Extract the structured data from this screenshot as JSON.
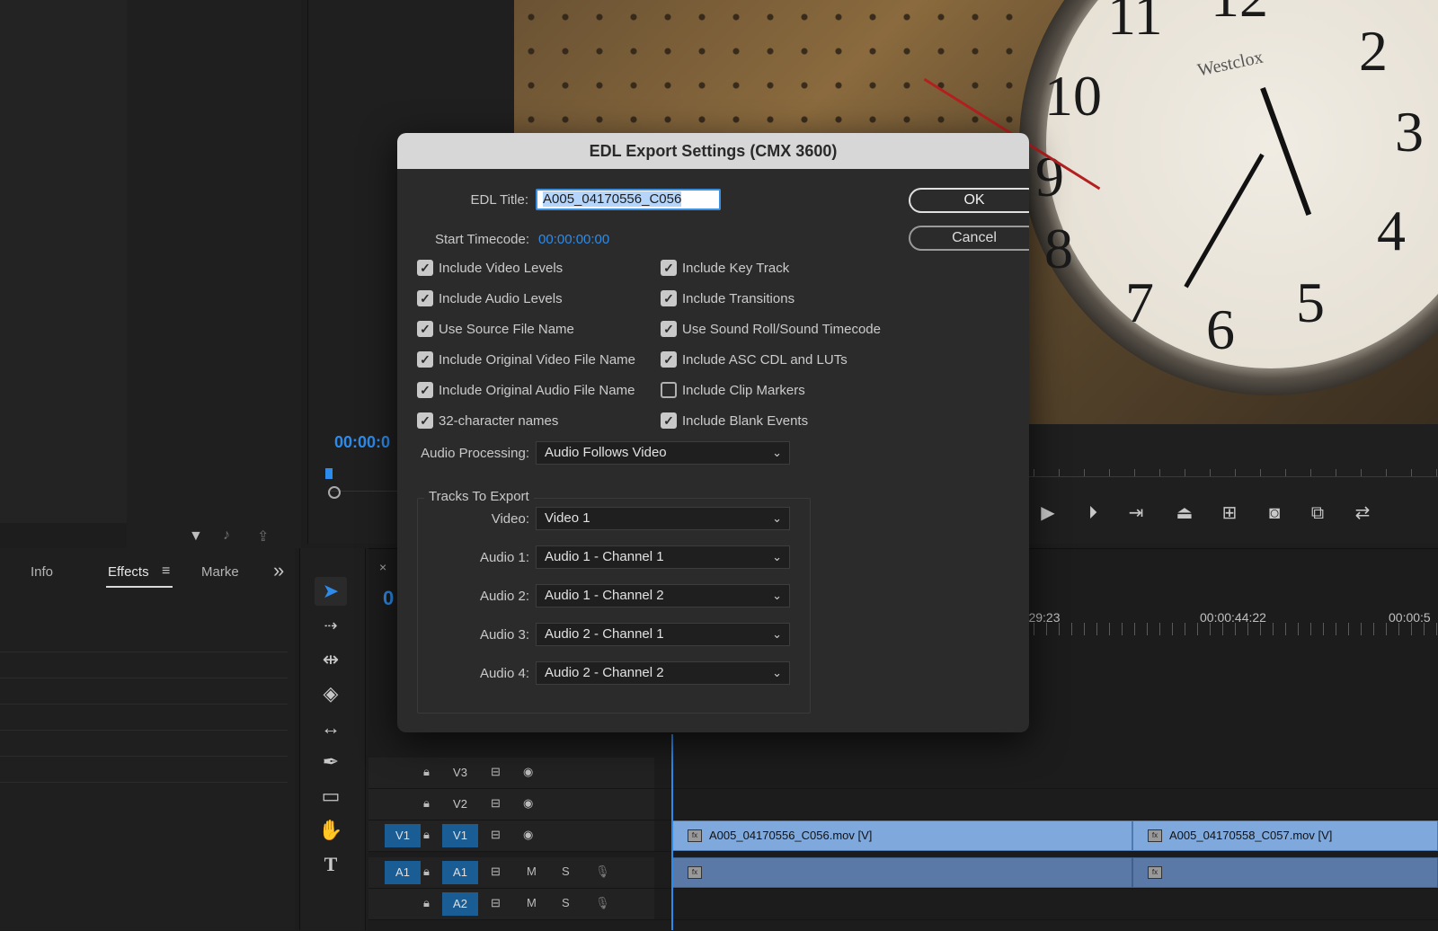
{
  "dialog": {
    "title": "EDL Export Settings (CMX 3600)",
    "edl_title_label": "EDL Title:",
    "edl_title_value": "A005_04170556_C056",
    "start_timecode_label": "Start Timecode:",
    "start_timecode_value": "00:00:00:00",
    "ok_label": "OK",
    "cancel_label": "Cancel",
    "checkboxes_left": [
      {
        "label": "Include Video Levels",
        "checked": true
      },
      {
        "label": "Include Audio Levels",
        "checked": true
      },
      {
        "label": "Use Source File Name",
        "checked": true
      },
      {
        "label": "Include Original Video File Name",
        "checked": true
      },
      {
        "label": "Include Original Audio File Name",
        "checked": true
      },
      {
        "label": "32-character names",
        "checked": true
      }
    ],
    "checkboxes_right": [
      {
        "label": "Include Key Track",
        "checked": true
      },
      {
        "label": "Include Transitions",
        "checked": true
      },
      {
        "label": "Use Sound Roll/Sound Timecode",
        "checked": true
      },
      {
        "label": "Include ASC CDL and LUTs",
        "checked": true
      },
      {
        "label": "Include Clip Markers",
        "checked": false
      },
      {
        "label": "Include Blank Events",
        "checked": true
      }
    ],
    "audio_processing_label": "Audio Processing:",
    "audio_processing_value": "Audio Follows Video",
    "tracks_group_label": "Tracks To Export",
    "tracks": [
      {
        "label": "Video:",
        "value": "Video 1"
      },
      {
        "label": "Audio 1:",
        "value": "Audio 1 - Channel 1"
      },
      {
        "label": "Audio 2:",
        "value": "Audio 1 - Channel 2"
      },
      {
        "label": "Audio 3:",
        "value": "Audio 2 - Channel 1"
      },
      {
        "label": "Audio 4:",
        "value": "Audio 2 - Channel 2"
      }
    ]
  },
  "source_monitor": {
    "timecode": "00:00:0"
  },
  "panels": {
    "tab_info": "Info",
    "tab_effects": "Effects",
    "tab_markers": "Marke",
    "overflow": "»"
  },
  "timeline": {
    "ruler": [
      "00:29:23",
      "00:00:44:22",
      "00:00:5"
    ],
    "partial_timecode": "0",
    "tracks": [
      {
        "source": "",
        "lock": "🔓",
        "name": "V3",
        "type": "video"
      },
      {
        "source": "",
        "lock": "🔓",
        "name": "V2",
        "type": "video"
      },
      {
        "source": "V1",
        "lock": "🔓",
        "name": "V1",
        "type": "video"
      },
      {
        "source": "A1",
        "lock": "🔓",
        "name": "A1",
        "type": "audio"
      },
      {
        "source": "",
        "lock": "🔓",
        "name": "A2",
        "type": "audio"
      }
    ],
    "clips": {
      "v1_clip1": "A005_04170556_C056.mov [V]",
      "v1_clip2": "A005_04170558_C057.mov [V]",
      "fx_badge": "fx"
    },
    "audio_buttons": {
      "mute": "M",
      "solo": "S"
    }
  },
  "program_view": {
    "brand": "Westclox",
    "clock_numbers": [
      "11",
      "12",
      "2",
      "10",
      "3",
      "9",
      "4",
      "8",
      "7",
      "6",
      "5"
    ]
  },
  "colors": {
    "accent_blue": "#2d8ceb",
    "clip_video": "#7fa9dd",
    "clip_audio": "#5a79a6",
    "track_target": "#1a5d94"
  }
}
